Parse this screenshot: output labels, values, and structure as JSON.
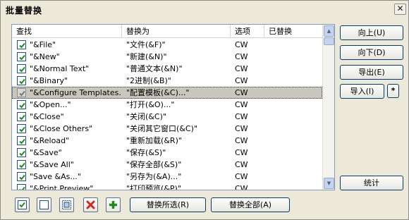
{
  "dialog": {
    "title": "批量替换",
    "close_glyph": "✕"
  },
  "table": {
    "columns": [
      "查找",
      "替换为",
      "选项",
      "已替换"
    ],
    "rows": [
      {
        "find": "\"&File\"",
        "replace": "\"文件(&F)\"",
        "option": "CW",
        "checked": true
      },
      {
        "find": "\"&New\"",
        "replace": "\"新建(&N)\"",
        "option": "CW",
        "checked": true
      },
      {
        "find": "\"&Normal Text\"",
        "replace": "\"普通文本(&N)\"",
        "option": "CW",
        "checked": true
      },
      {
        "find": "\"&Binary\"",
        "replace": "\"2进制(&B)\"",
        "option": "CW",
        "checked": true
      },
      {
        "find": "\"&Configure Templates...\"",
        "replace": "\"配置模板(&C)...\"",
        "option": "CW",
        "checked": true,
        "selected": true
      },
      {
        "find": "\"&Open...\"",
        "replace": "\"打开(&O)...\"",
        "option": "CW",
        "checked": true
      },
      {
        "find": "\"&Close\"",
        "replace": "\"关闭(&C)\"",
        "option": "CW",
        "checked": true
      },
      {
        "find": "\"&Close Others\"",
        "replace": "\"关闭其它窗口(&C)\"",
        "option": "CW",
        "checked": true
      },
      {
        "find": "\"&Reload\"",
        "replace": "\"重新加载(&R)\"",
        "option": "CW",
        "checked": true
      },
      {
        "find": "\"&Save\"",
        "replace": "\"保存(&S)\"",
        "option": "CW",
        "checked": true
      },
      {
        "find": "\"&Save All\"",
        "replace": "\"保存全部(&S)\"",
        "option": "CW",
        "checked": true
      },
      {
        "find": "\"Save &As...\"",
        "replace": "\"另存为(&A)...\"",
        "option": "CW",
        "checked": true
      },
      {
        "find": "\"&Print Preview\"",
        "replace": "\"打印预览(&P)\"",
        "option": "CW",
        "checked": true
      }
    ]
  },
  "buttons": {
    "move_up": "向上(U)",
    "move_down": "向下(D)",
    "export": "导出(E)",
    "import": "导入(I)",
    "star": "*",
    "stats": "统计",
    "replace_selected": "替换所选(R)",
    "replace_all": "替换全部(A)"
  },
  "toolbar_icons": [
    "check-all-icon",
    "uncheck-all-icon",
    "invert-selection-icon",
    "delete-icon",
    "add-icon"
  ],
  "colors": {
    "accent_green": "#1e8a1e",
    "delete_red": "#d42a1e",
    "selection": "#c9c7bd"
  }
}
